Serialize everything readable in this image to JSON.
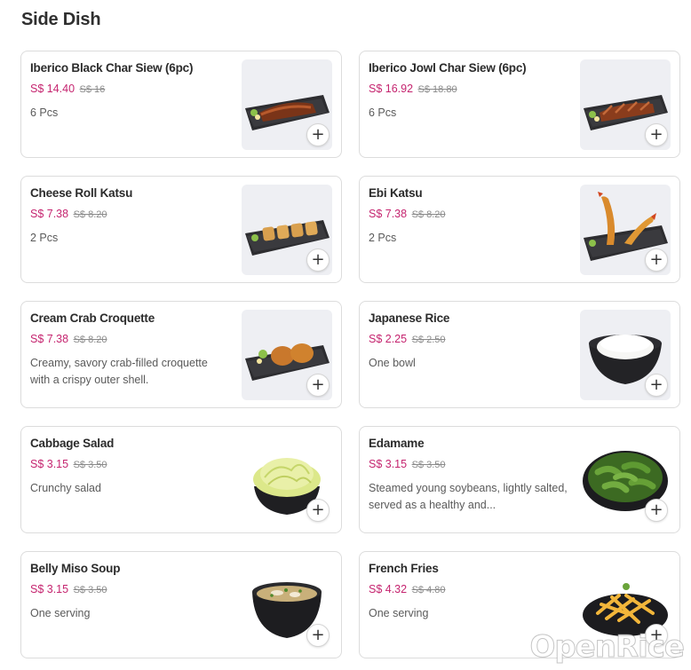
{
  "section": {
    "title": "Side Dish"
  },
  "add_icon": "plus-icon",
  "accent_color": "#c5246f",
  "watermark": "OpenRice",
  "items": [
    {
      "name": "Iberico Black Char Siew (6pc)",
      "price": "S$ 14.40",
      "old_price": "S$ 16",
      "desc": "6 Pcs",
      "image": "char-siew-plate"
    },
    {
      "name": "Iberico Jowl Char Siew (6pc)",
      "price": "S$ 16.92",
      "old_price": "S$ 18.80",
      "desc": "6 Pcs",
      "image": "jowl-char-siew-plate"
    },
    {
      "name": "Cheese Roll Katsu",
      "price": "S$ 7.38",
      "old_price": "S$ 8.20",
      "desc": "2 Pcs",
      "image": "cheese-roll-katsu-plate"
    },
    {
      "name": "Ebi Katsu",
      "price": "S$ 7.38",
      "old_price": "S$ 8.20",
      "desc": "2 Pcs",
      "image": "ebi-katsu-plate"
    },
    {
      "name": "Cream Crab Croquette",
      "price": "S$ 7.38",
      "old_price": "S$ 8.20",
      "desc": "Creamy, savory crab-filled croquette with a crispy outer shell.",
      "image": "croquette-plate"
    },
    {
      "name": "Japanese Rice",
      "price": "S$ 2.25",
      "old_price": "S$ 2.50",
      "desc": "One bowl",
      "image": "rice-bowl"
    },
    {
      "name": "Cabbage Salad",
      "price": "S$ 3.15",
      "old_price": "S$ 3.50",
      "desc": "Crunchy salad",
      "image": "cabbage-bowl"
    },
    {
      "name": "Edamame",
      "price": "S$ 3.15",
      "old_price": "S$ 3.50",
      "desc": "Steamed young soybeans, lightly salted, served as a healthy and...",
      "image": "edamame-bowl"
    },
    {
      "name": "Belly Miso Soup",
      "price": "S$ 3.15",
      "old_price": "S$ 3.50",
      "desc": "One serving",
      "image": "miso-soup-bowl"
    },
    {
      "name": "French Fries",
      "price": "S$ 4.32",
      "old_price": "S$ 4.80",
      "desc": "One serving",
      "image": "fries-plate"
    }
  ]
}
